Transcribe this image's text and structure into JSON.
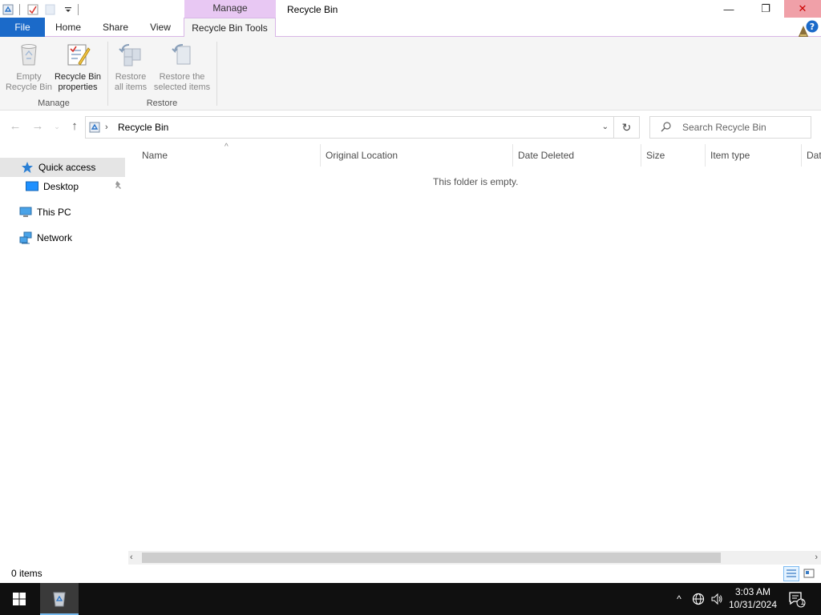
{
  "window": {
    "title": "Recycle Bin",
    "contextual_group": "Manage",
    "minimize_symbol": "—",
    "restore_symbol": "❐",
    "close_symbol": "✕"
  },
  "ribbon": {
    "tabs": {
      "file": "File",
      "home": "Home",
      "share": "Share",
      "view": "View",
      "recycle_bin_tools": "Recycle Bin Tools"
    },
    "manage_group": {
      "label": "Manage",
      "empty_line1": "Empty",
      "empty_line2": "Recycle Bin",
      "props_line1": "Recycle Bin",
      "props_line2": "properties"
    },
    "restore_group": {
      "label": "Restore",
      "restore_all_line1": "Restore",
      "restore_all_line2": "all items",
      "restore_sel_line1": "Restore the",
      "restore_sel_line2": "selected items"
    }
  },
  "address": {
    "location": "Recycle Bin",
    "search_placeholder": "Search Recycle Bin"
  },
  "nav": {
    "quick_access": "Quick access",
    "desktop": "Desktop",
    "this_pc": "This PC",
    "network": "Network"
  },
  "columns": [
    "Name",
    "Original Location",
    "Date Deleted",
    "Size",
    "Item type",
    "Dat"
  ],
  "empty_message": "This folder is empty.",
  "status": {
    "item_count": "0 items"
  },
  "taskbar": {
    "time": "3:03 AM",
    "date": "10/31/2024",
    "notification_count": "1"
  },
  "colors": {
    "file_tab": "#1b6ac9",
    "contextual_tab": "#e8c8f3",
    "selected_nav": "#e5e5e5",
    "taskbar": "#101010"
  }
}
